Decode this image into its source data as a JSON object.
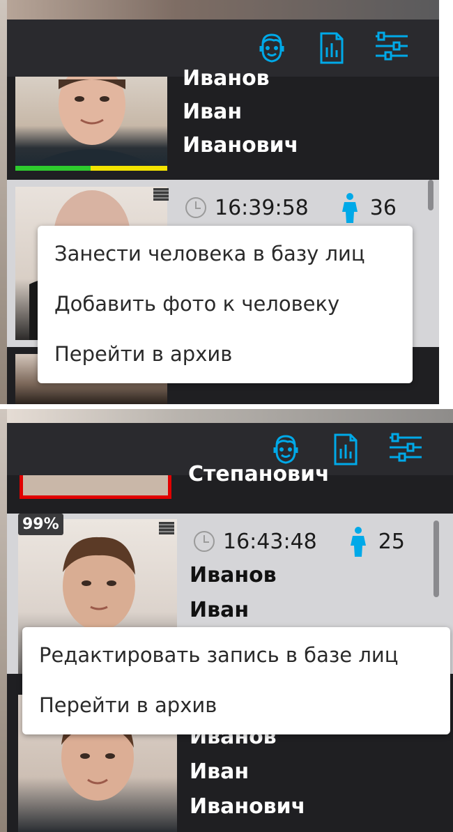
{
  "toolbar": {
    "icons": [
      "face-db-icon",
      "report-icon",
      "settings-sliders-icon"
    ],
    "accent_color": "#00a9e8"
  },
  "top_panel": {
    "match_entry": {
      "name_lines": [
        "Иванов",
        "Иван",
        "Иванович"
      ]
    },
    "event_entry": {
      "time": "16:39:58",
      "count": "36"
    },
    "context_menu": {
      "items": [
        "Занести человека в базу лиц",
        "Добавить фото к человеку",
        "Перейти в архив"
      ]
    }
  },
  "bottom_panel": {
    "prev_entry": {
      "name_tail": "Степанович"
    },
    "match_entry": {
      "confidence": "99%",
      "time": "16:43:48",
      "count": "25",
      "name_lines": [
        "Иванов",
        "Иван"
      ]
    },
    "context_menu": {
      "items": [
        "Редактировать запись в базе лиц",
        "Перейти в архив"
      ]
    },
    "next_entry": {
      "name_lines": [
        "Иванов",
        "Иван",
        "Иванович"
      ]
    }
  }
}
